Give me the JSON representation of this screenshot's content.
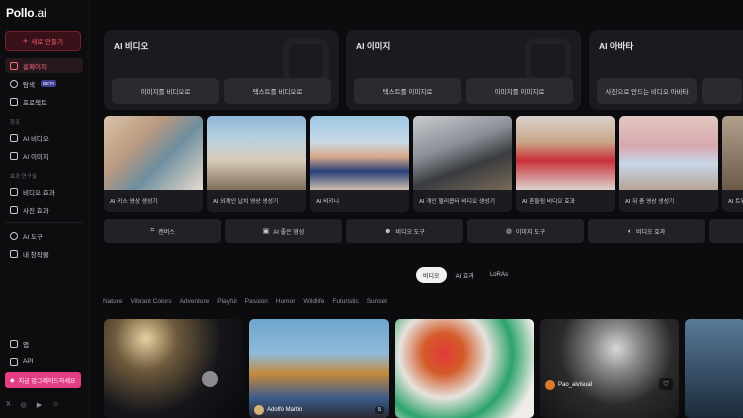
{
  "brand": {
    "logo_main": "Pollo",
    "logo_suffix": ".ai"
  },
  "sidebar": {
    "create_label": "새로 만들기",
    "items": [
      {
        "label": "홈페이지",
        "icon": "home-icon"
      },
      {
        "label": "탐색",
        "icon": "compass-icon",
        "badge": "BETA"
      },
      {
        "label": "프로젝트",
        "icon": "folder-icon"
      }
    ],
    "section_create": "창조",
    "create_items": [
      {
        "label": "AI 비디오",
        "icon": "video-icon"
      },
      {
        "label": "AI 이미지",
        "icon": "image-icon"
      }
    ],
    "section_effects": "효과 연구실",
    "effect_items": [
      {
        "label": "비디오 효과",
        "icon": "video-effect-icon"
      },
      {
        "label": "사진 효과",
        "icon": "photo-effect-icon"
      }
    ],
    "tool_items": [
      {
        "label": "AI 도구",
        "icon": "tools-icon"
      },
      {
        "label": "내 창작물",
        "icon": "creations-icon"
      }
    ],
    "bottom_items": [
      {
        "label": "앱",
        "icon": "phone-icon"
      },
      {
        "label": "API",
        "icon": "api-icon"
      }
    ],
    "upgrade_label": "지금 업그레이드하세요",
    "socials": [
      "X",
      "◎",
      "▶",
      "☺"
    ]
  },
  "features": [
    {
      "title": "AI 비디오",
      "buttons": [
        "이미지를 비디오로",
        "텍스트를 비디오로"
      ]
    },
    {
      "title": "AI 이미지",
      "buttons": [
        "텍스트를 이미지로",
        "이미지를 이미지로"
      ]
    },
    {
      "title": "AI 아바타",
      "buttons": [
        "사진으로 만드는 비디오 아바타",
        ""
      ]
    }
  ],
  "templates": [
    {
      "caption": "AI 키스 영상 생성기"
    },
    {
      "caption": "AI 외계인 납치 영상 생성기"
    },
    {
      "caption": "AI 비키니"
    },
    {
      "caption": "AI 개인 헬리콥터 비디오 생성기"
    },
    {
      "caption": "AI 흔들림 비디오 효과"
    },
    {
      "caption": "AI 뒤 춤 영상 생성기"
    },
    {
      "caption": "AI 트위"
    }
  ],
  "tools": [
    {
      "label": "캔버스",
      "icon": "⌗"
    },
    {
      "label": "AI 좋은 영상",
      "icon": "▣"
    },
    {
      "label": "비디오 도구",
      "icon": "☻"
    },
    {
      "label": "이미지 도구",
      "icon": "◍"
    },
    {
      "label": "비디오 효과",
      "icon": "◐"
    }
  ],
  "feed_tabs": [
    "비디오",
    "AI 효과",
    "LoRAs"
  ],
  "tags": [
    "Nature",
    "Vibrant Colors",
    "Adventure",
    "Playful",
    "Passion",
    "Humor",
    "Wildlife",
    "Futuristic",
    "Sunset"
  ],
  "gallery": [
    {
      "author": "",
      "count": ""
    },
    {
      "author": "Adolfo Martin",
      "count": "5"
    },
    {
      "author": "",
      "count": ""
    },
    {
      "author": "Pao_aivisual",
      "count": ""
    },
    {
      "author": "",
      "count": ""
    }
  ],
  "colors": {
    "accent": "#ff5d74",
    "upgrade": "#e43d86",
    "card": "#1a1a1f"
  }
}
